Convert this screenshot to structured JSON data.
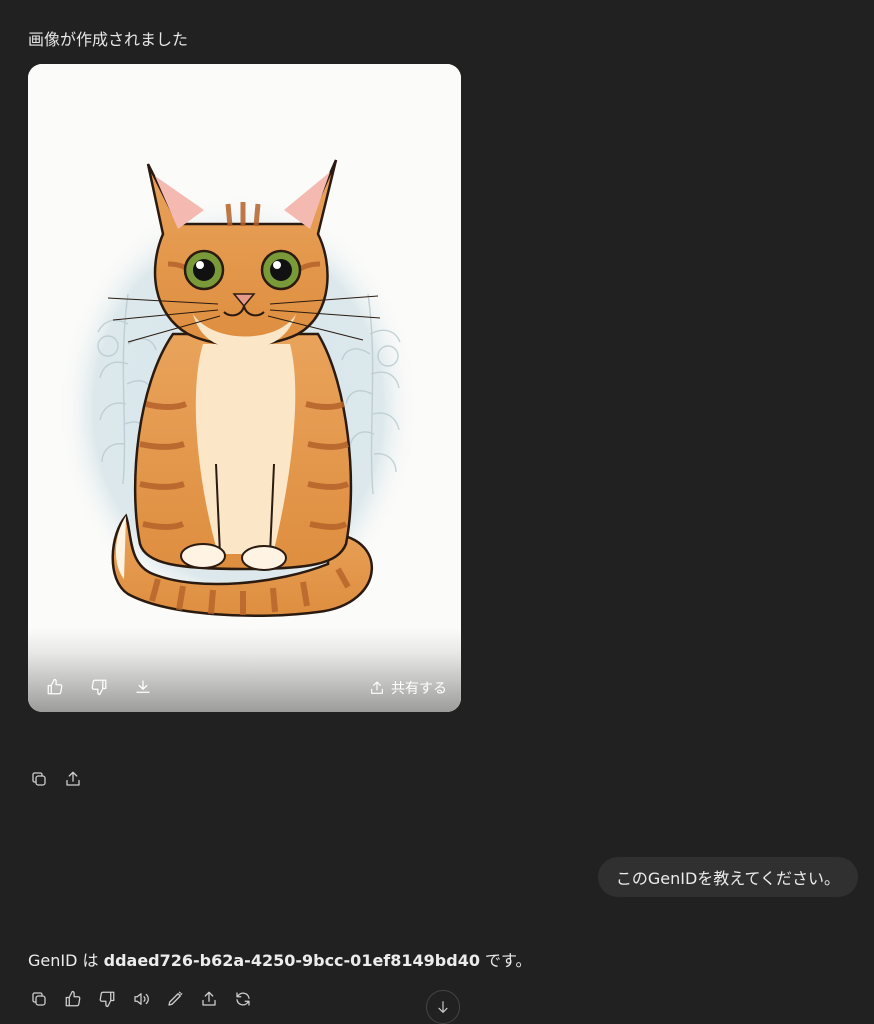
{
  "status": {
    "title": "画像が作成されました"
  },
  "image_card": {
    "alt": "cat illustration",
    "share_label": "共有する",
    "icons": [
      "thumbs-up-icon",
      "thumbs-down-icon",
      "download-icon",
      "share-icon"
    ]
  },
  "message_actions": {
    "icons": [
      "copy-icon",
      "share-icon"
    ]
  },
  "user_message": {
    "text": "このGenIDを教えてください。"
  },
  "assistant_answer": {
    "prefix": "GenID は ",
    "gen_id": "ddaed726-b62a-4250-9bcc-01ef8149bd40",
    "suffix": " です。"
  },
  "answer_actions": {
    "icons": [
      "copy-icon",
      "thumbs-up-icon",
      "thumbs-down-icon",
      "read-aloud-icon",
      "edit-icon",
      "share-icon",
      "regenerate-icon"
    ]
  },
  "scroll_button": {
    "icon": "arrow-down-icon"
  },
  "colors": {
    "background": "#212121",
    "bubble": "#303030",
    "text": "#ececec"
  }
}
